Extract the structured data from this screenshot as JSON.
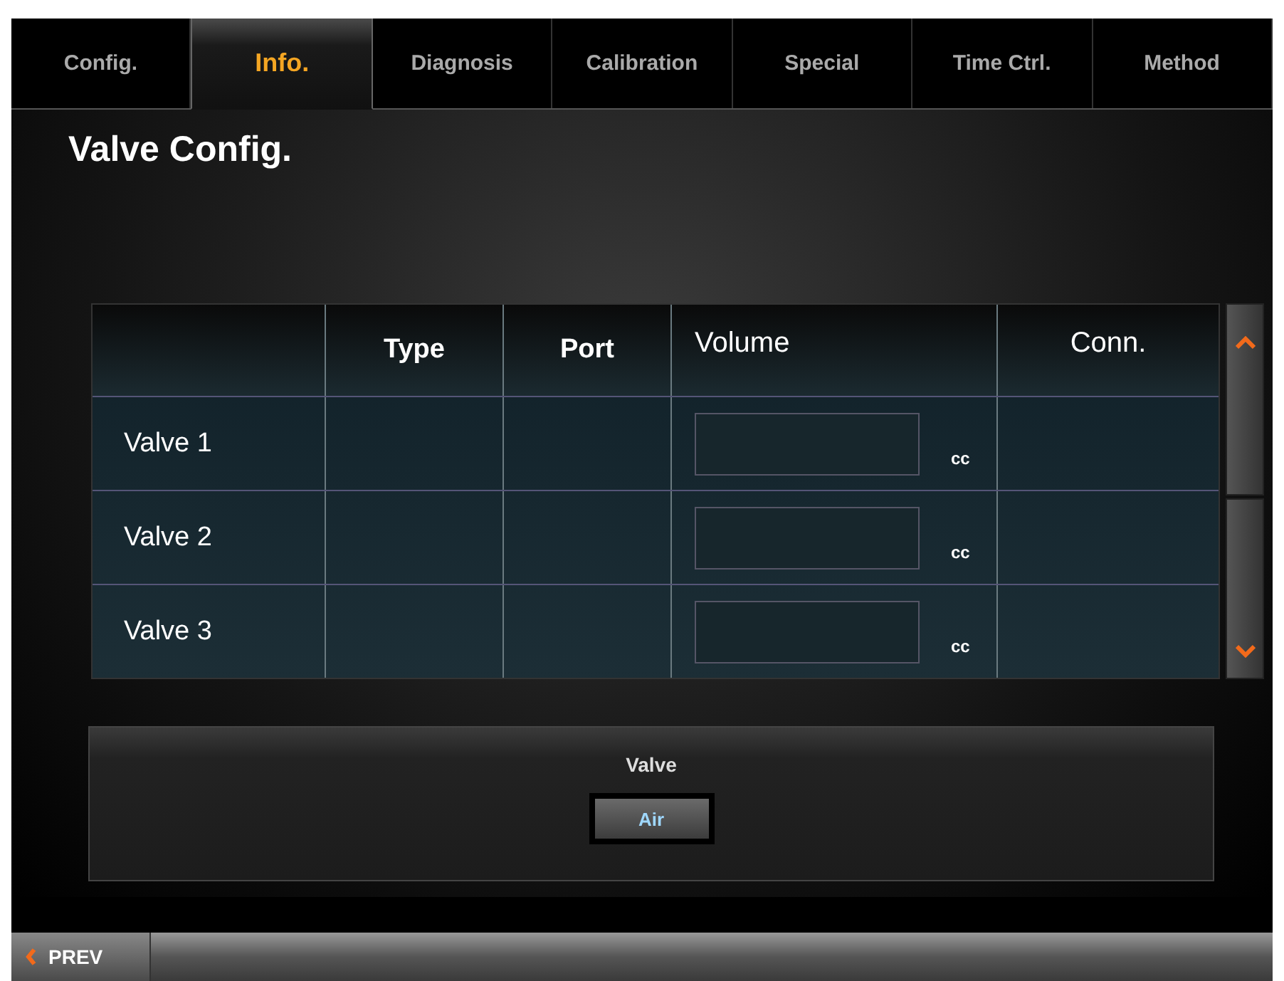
{
  "tabs": [
    {
      "label": "Config.",
      "selected": false
    },
    {
      "label": "Info.",
      "selected": true
    },
    {
      "label": "Diagnosis",
      "selected": false
    },
    {
      "label": "Calibration",
      "selected": false
    },
    {
      "label": "Special",
      "selected": false
    },
    {
      "label": "Time Ctrl.",
      "selected": false
    },
    {
      "label": "Method",
      "selected": false
    }
  ],
  "page_title": "Valve Config.",
  "table": {
    "columns": [
      "",
      "Type",
      "Port",
      "Volume",
      "Conn."
    ],
    "rows": [
      {
        "name": "Valve 1",
        "unit": "cc"
      },
      {
        "name": "Valve 2",
        "unit": "cc"
      },
      {
        "name": "Valve 3",
        "unit": "cc"
      }
    ]
  },
  "valve_panel": {
    "label": "Valve",
    "button": "Air"
  },
  "footer": {
    "prev": "PREV"
  }
}
